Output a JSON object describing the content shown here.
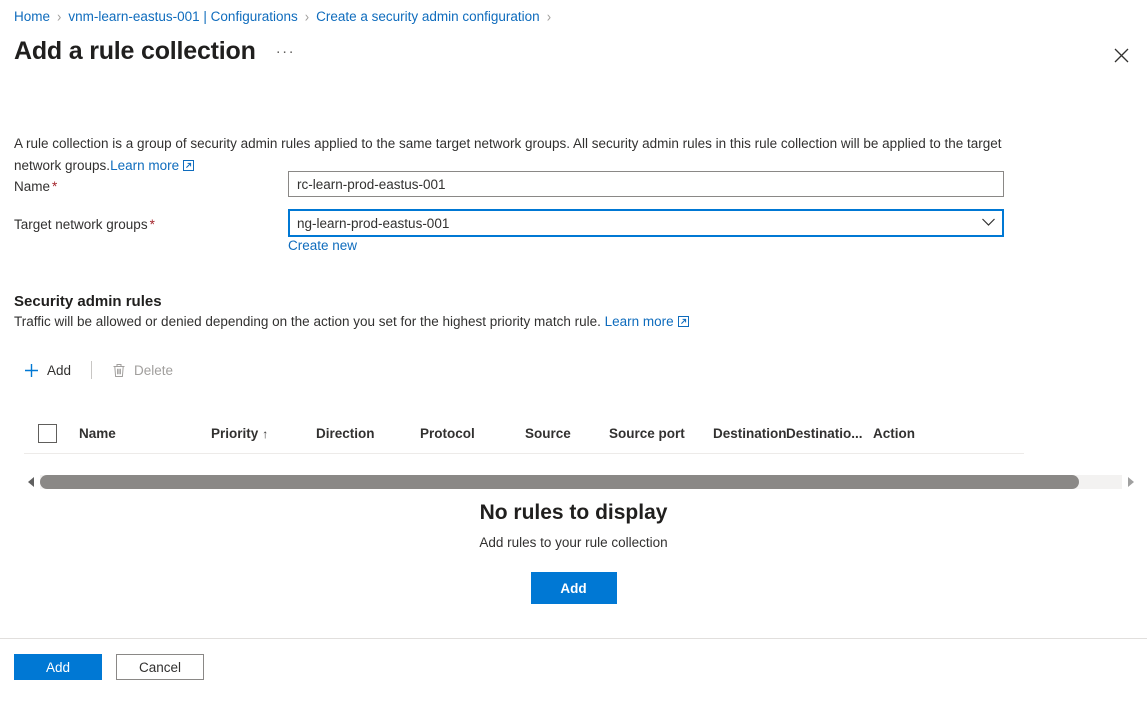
{
  "breadcrumb": {
    "items": [
      {
        "label": "Home"
      },
      {
        "label": "vnm-learn-eastus-001 | Configurations"
      },
      {
        "label": "Create a security admin configuration"
      }
    ],
    "separator": "›"
  },
  "header": {
    "title": "Add a rule collection",
    "ellipsis": "···",
    "close_icon": "close-icon"
  },
  "description": {
    "text": "A rule collection is a group of security admin rules applied to the same target network groups. All security admin rules in this rule collection will be applied to the target network groups.",
    "learn_more": "Learn more"
  },
  "form": {
    "name": {
      "label": "Name",
      "required": "*",
      "value": "rc-learn-prod-eastus-001",
      "placeholder": ""
    },
    "target_network_groups": {
      "label": "Target network groups",
      "required": "*",
      "value": "ng-learn-prod-eastus-001",
      "chevron_icon": "chevron-down-icon",
      "create_new": "Create new"
    }
  },
  "rules_section": {
    "title": "Security admin rules",
    "description": "Traffic will be allowed or denied depending on the action you set for the highest priority match rule.",
    "learn_more": "Learn more",
    "toolbar": {
      "add_label": "Add",
      "add_icon": "plus-icon",
      "delete_label": "Delete",
      "delete_icon": "trash-icon",
      "delete_disabled": true,
      "highlight_color": "#e74c3c"
    },
    "table": {
      "columns": [
        {
          "label": "Name",
          "sorted": false
        },
        {
          "label": "Priority",
          "sorted": true,
          "sort_arrow": "↑"
        },
        {
          "label": "Direction",
          "sorted": false
        },
        {
          "label": "Protocol",
          "sorted": false
        },
        {
          "label": "Source",
          "sorted": false
        },
        {
          "label": "Source port",
          "sorted": false
        },
        {
          "label": "Destination",
          "sorted": false
        },
        {
          "label": "Destinatio...",
          "sorted": false
        },
        {
          "label": "Action",
          "sorted": false
        }
      ],
      "rows": [],
      "select_all_checked": false
    },
    "scrollbar": {
      "left_arrow_icon": "caret-left-icon",
      "right_arrow_icon": "caret-right-icon",
      "thumb_percent": "96"
    },
    "empty_state": {
      "title": "No rules to display",
      "subtitle": "Add rules to your rule collection",
      "button_label": "Add"
    }
  },
  "footer": {
    "add_label": "Add",
    "cancel_label": "Cancel"
  },
  "colors": {
    "accent": "#0078d4",
    "link": "#0f6cbd",
    "required": "#a4262c",
    "highlight": "#e74c3c"
  }
}
